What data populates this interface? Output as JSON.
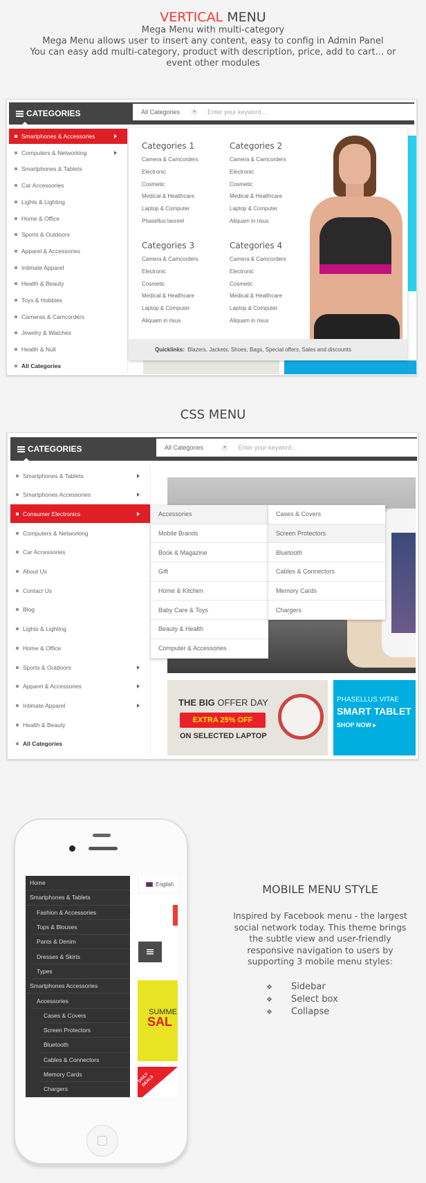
{
  "section1": {
    "title_accent": "VERTICAL",
    "title_rest": " MENU",
    "subtitle": "Mega Menu with multi-category",
    "lines": [
      "Mega Menu allows user to insert any content,  easy to config  in Admin Panel",
      "You can easy add multi-category, product with description, price, add to cart... or",
      "event other modules"
    ]
  },
  "header": {
    "categories": "CATEGORIES",
    "select": "All Categories",
    "placeholder": "Enter your keyword..."
  },
  "vertical_menu": {
    "items": [
      "Smartphones & Accessories",
      "Computers & Networking",
      "Smartphones & Tablets",
      "Car Accessories",
      "Lights & Lighting",
      "Home & Office",
      "Sports & Outdoors",
      "Apparel & Accessories",
      "Intimate Apparel",
      "Health & Beauty",
      "Toys & Hobbies",
      "Cameras & Camcorders",
      "Jewelry & Watches",
      "Health & Null",
      "All Categories"
    ]
  },
  "mega": {
    "columns": [
      {
        "title": "Categories 1",
        "links": [
          "Camera & Camcorders",
          "Electronic",
          "Cosmetic",
          "Medical & Healthcare",
          "Laptop & Computer",
          "Phasellus laoreet"
        ]
      },
      {
        "title": "Categories 2",
        "links": [
          "Camera & Camcorders",
          "Electronic",
          "Cosmetic",
          "Medical & Healthcare",
          "Laptop & Computer",
          "Aliquam in risus"
        ]
      },
      {
        "title": "Categories 3",
        "links": [
          "Camera & Camcorders",
          "Electronic",
          "Cosmetic",
          "Medical & Healthcare",
          "Laptop & Computer",
          "Aliquam in risus"
        ]
      },
      {
        "title": "Categories 4",
        "links": [
          "Camera & Camcorders",
          "Electronic",
          "Cosmetic",
          "Medical & Healthcare",
          "Laptop & Computer",
          "Aliquam in risus"
        ]
      }
    ],
    "quicklinks_label": "Quicklinks:",
    "quicklinks": "Blazers,  Jackets,  Shoes,  Bags,  Special offers,  Sales and discounts"
  },
  "section2": {
    "title": "CSS MENU"
  },
  "css_menu": {
    "items": [
      "Smartphones & Tablets",
      "Smartphones Accessories",
      "Consumer Electronics",
      "Computers & Networking",
      "Car Accessories",
      "About Us",
      "Contact Us",
      "Blog",
      "Lights & Lighting",
      "Home & Office",
      "Sports & Outdoors",
      "Apparel & Accessories",
      "Intimate Apparel",
      "Health & Beauty",
      "All Categories"
    ],
    "sub1": [
      "Accessories",
      "Mobile Brands",
      "Book & Magazine",
      "Gift",
      "Home & Kitchen",
      "Baby Care & Toys",
      "Beauty & Health",
      "Computer & Accessories"
    ],
    "sub2": [
      "Cases & Covers",
      "Screen Protectors",
      "Bluetooth",
      "Cables & Connectors",
      "Memory Cards",
      "Chargers"
    ]
  },
  "banners": {
    "offer_title_bold": "THE BIG",
    "offer_title": " OFFER DAY",
    "offer_badge": "EXTRA 25% OFF",
    "offer_sub": "ON SELECTED LAPTOP",
    "tablet_small": "PHASELLUS VITAE",
    "tablet_big": "SMART TABLET",
    "tablet_cta": "SHOP NOW ▸"
  },
  "section3": {
    "title": "MOBILE MENU STYLE",
    "paragraph": [
      "Inspired by Facebook menu - the largest",
      "social network today. This theme brings",
      "the subtle view and user-friendly",
      "responsive navigation to users by",
      "supporting 3 mobile menu styles:"
    ],
    "bullets": [
      "Sidebar",
      "Select box",
      "Collapse"
    ]
  },
  "mobile": {
    "language": "English",
    "menu": [
      {
        "label": "Home",
        "level": 0
      },
      {
        "label": "Smartphones & Tablets",
        "level": 0
      },
      {
        "label": "Fashion & Accessories",
        "level": 1
      },
      {
        "label": "Tops & Blouses",
        "level": 1
      },
      {
        "label": "Pants & Denim",
        "level": 1
      },
      {
        "label": "Dresses & Skirts",
        "level": 1
      },
      {
        "label": "Types",
        "level": 1
      },
      {
        "label": "Smartphones Accessories",
        "level": 0
      },
      {
        "label": "Accessories",
        "level": 1
      },
      {
        "label": "Cases & Covers",
        "level": 2
      },
      {
        "label": "Screen Protectors",
        "level": 2
      },
      {
        "label": "Bluetooth",
        "level": 2
      },
      {
        "label": "Cables & Connectors",
        "level": 2
      },
      {
        "label": "Memory Cards",
        "level": 2
      },
      {
        "label": "Chargers",
        "level": 2
      }
    ],
    "banner_summer": "SUMME",
    "banner_sale": "SAL",
    "banner_daily": "DAILY",
    "banner_deals": "DEALS"
  },
  "colors": {
    "accent": "#e01e26",
    "dark": "#444444",
    "cyan": "#00aee0"
  }
}
